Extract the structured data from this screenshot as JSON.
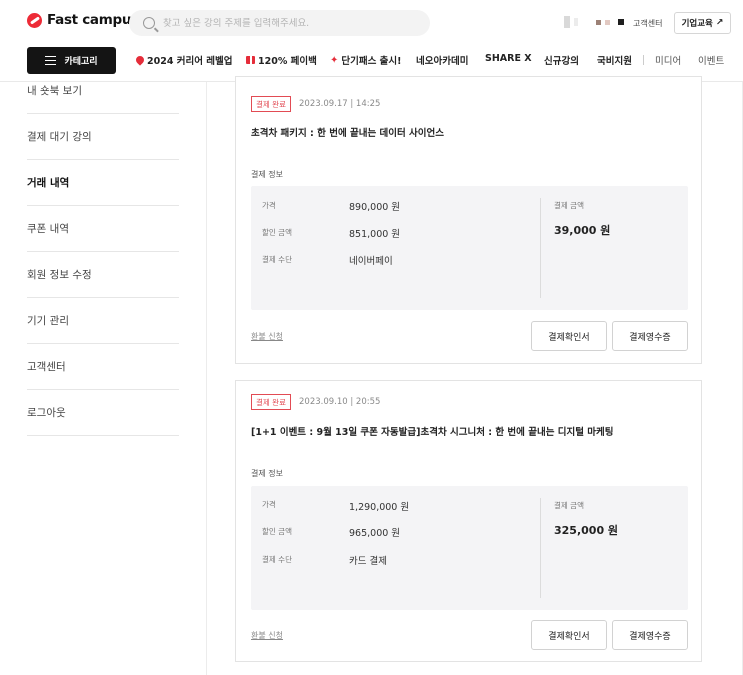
{
  "header": {
    "logo_text": "Fast campus",
    "search_placeholder": "찾고 싶은 강의 주제를 입력해주세요.",
    "cs_link": "고객센터",
    "corp_button": "기업교육",
    "category_button": "카테고리",
    "nav": [
      {
        "label": "2024 커리어 레벨업",
        "icon": "pin-icon"
      },
      {
        "label": "120% 페이백",
        "icon": "gift-icon"
      },
      {
        "label": "단기패스 출시!",
        "icon": "sparkle-icon"
      },
      {
        "label": "네오아카데미"
      },
      {
        "label": "SHARE X"
      },
      {
        "label": "신규강의"
      },
      {
        "label": "국비지원"
      },
      {
        "label": "미디어"
      },
      {
        "label": "이벤트"
      }
    ]
  },
  "sidebar": {
    "items": [
      {
        "label": "내 숏북 보기"
      },
      {
        "label": "결제 대기 강의"
      },
      {
        "label": "거래 내역"
      },
      {
        "label": "쿠폰 내역"
      },
      {
        "label": "회원 정보 수정"
      },
      {
        "label": "기기 관리"
      },
      {
        "label": "고객센터"
      },
      {
        "label": "로그아웃"
      }
    ]
  },
  "orders": [
    {
      "status": "결제 완료",
      "date": "2023.09.17 | 14:25",
      "title": "초격차 패키지 : 한 번에 끝내는 데이터 사이언스",
      "section_label": "결제 정보",
      "price_label": "가격",
      "price": "890,000 원",
      "discount_label": "할인 금액",
      "discount": "851,000 원",
      "method_label": "결제 수단",
      "method": "네이버페이",
      "paid_label": "결제 금액",
      "paid": "39,000 원",
      "refund": "환불 신청",
      "confirm_button": "결제확인서",
      "receipt_button": "결제영수증"
    },
    {
      "status": "결제 완료",
      "date": "2023.09.10 | 20:55",
      "title": "[1+1 이벤트 : 9월 13일 쿠폰 자동발급]초격차 시그니처 : 한 번에 끝내는 디지털 마케팅",
      "section_label": "결제 정보",
      "price_label": "가격",
      "price": "1,290,000 원",
      "discount_label": "할인 금액",
      "discount": "965,000 원",
      "method_label": "결제 수단",
      "method": "카드 결제",
      "paid_label": "결제 금액",
      "paid": "325,000 원",
      "refund": "환불 신청",
      "confirm_button": "결제확인서",
      "receipt_button": "결제영수증"
    }
  ],
  "colors": {
    "brand": "#ed2b37",
    "badge": "#e24b54",
    "dark": "#141414"
  }
}
